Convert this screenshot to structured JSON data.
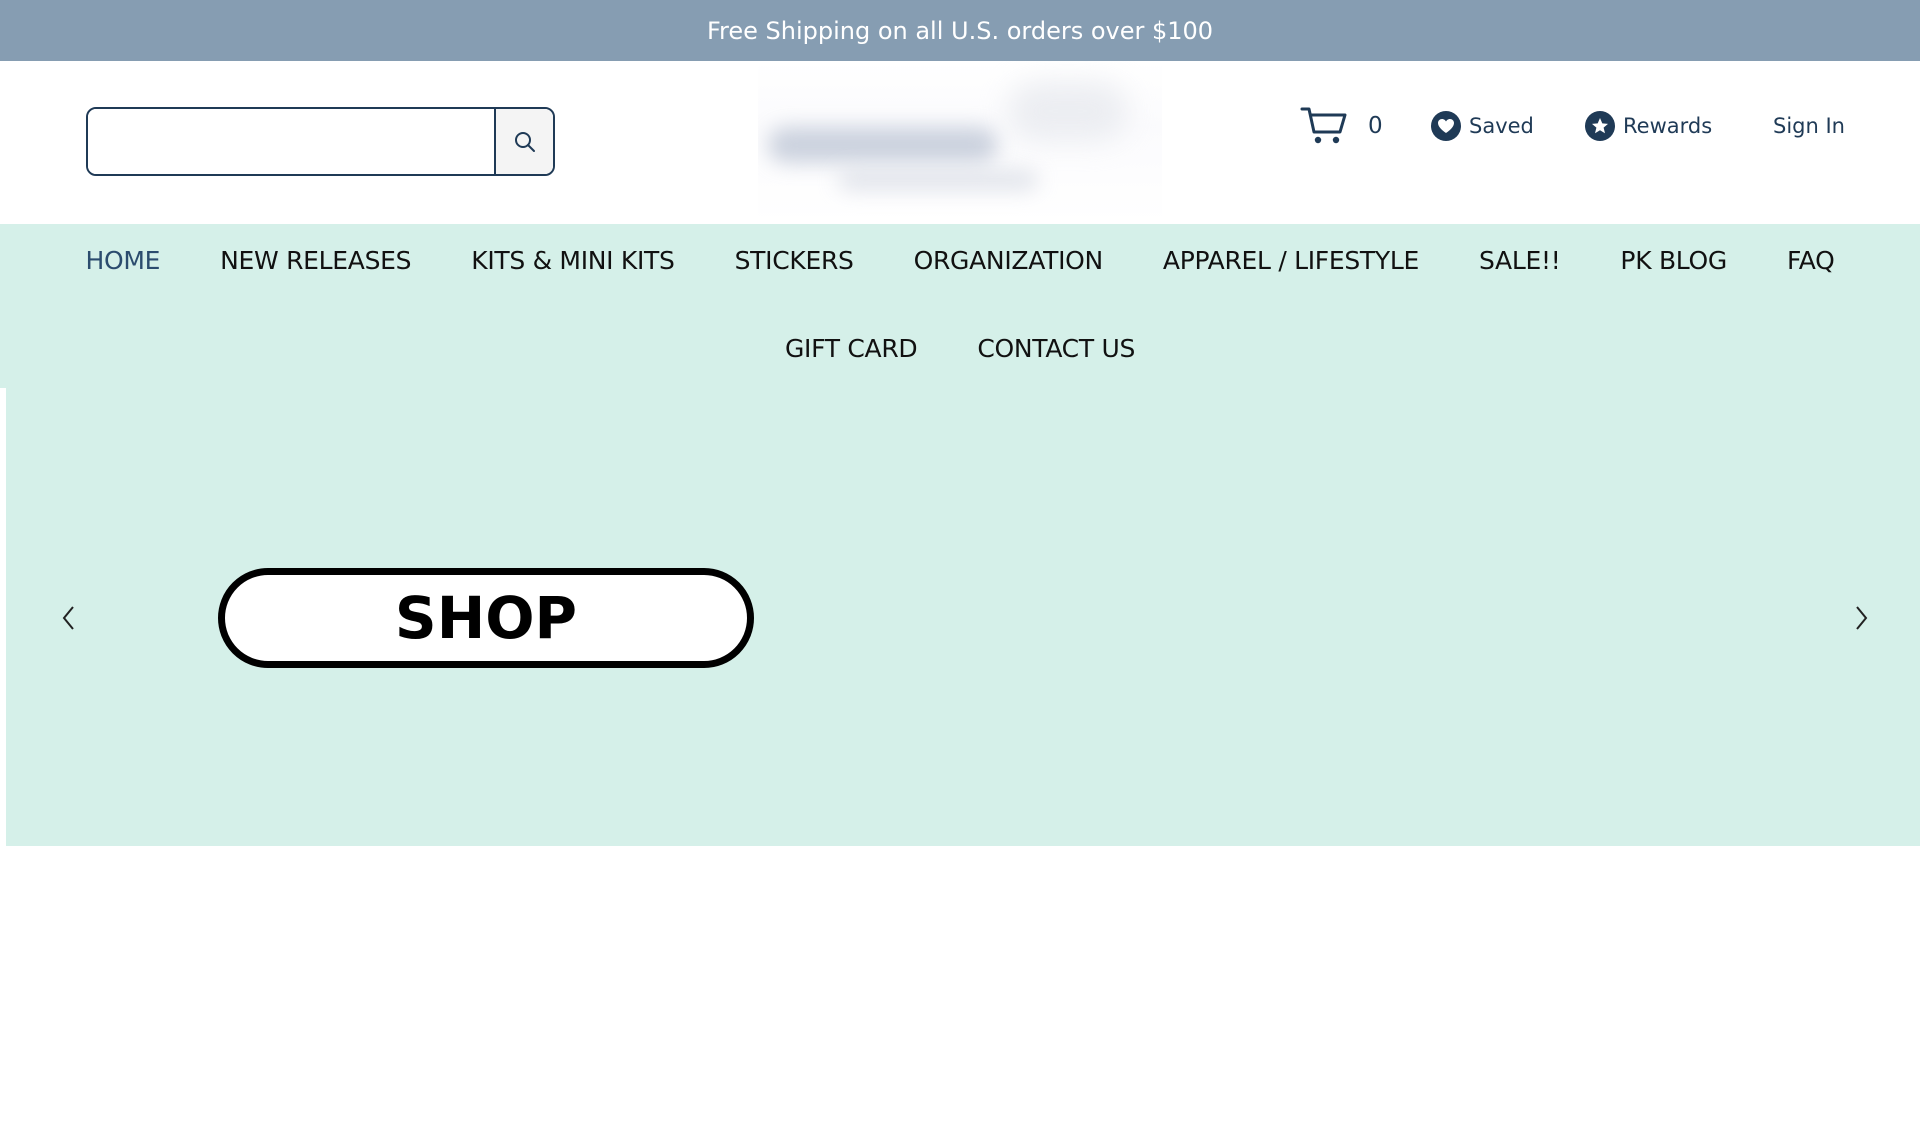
{
  "announcement": {
    "text": "Free Shipping on all U.S. orders over $100"
  },
  "header": {
    "search": {
      "placeholder": "",
      "value": ""
    },
    "cart": {
      "count": "0"
    },
    "saved_label": "Saved",
    "rewards_label": "Rewards",
    "signin_label": "Sign In"
  },
  "nav": {
    "row1": [
      {
        "label": "HOME",
        "active": true
      },
      {
        "label": "NEW RELEASES"
      },
      {
        "label": "KITS & MINI KITS"
      },
      {
        "label": "STICKERS"
      },
      {
        "label": "ORGANIZATION"
      },
      {
        "label": "APPAREL / LIFESTYLE"
      },
      {
        "label": "SALE!!"
      },
      {
        "label": "PK BLOG"
      },
      {
        "label": "FAQ"
      }
    ],
    "row2": [
      {
        "label": "GIFT CARD"
      },
      {
        "label": "CONTACT US"
      }
    ]
  },
  "hero": {
    "button_label": "SHOP"
  },
  "colors": {
    "announcement_bg": "#869db2",
    "nav_bg": "#d5f0e9",
    "brand_navy": "#1f3a56"
  },
  "icons": {
    "search": "search-icon",
    "cart": "cart-icon",
    "saved": "heart-icon",
    "rewards": "star-icon",
    "prev": "chevron-left-icon",
    "next": "chevron-right-icon"
  }
}
